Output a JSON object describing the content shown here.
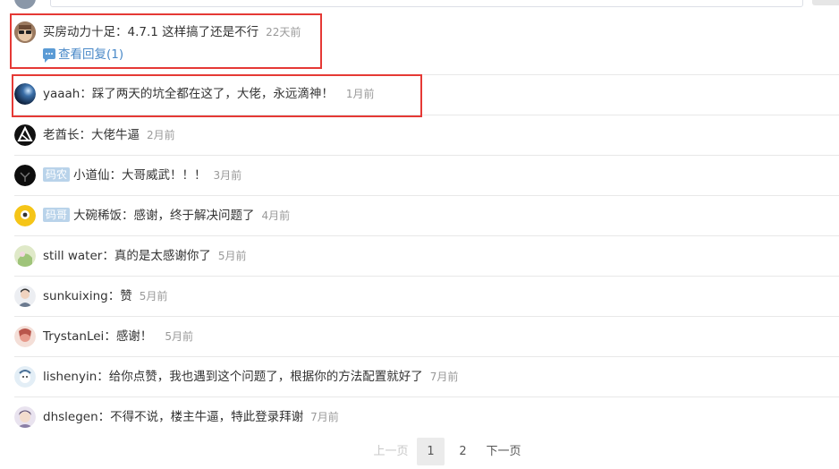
{
  "comments": [
    {
      "user": "买房动力十足",
      "text": "4.7.1 这样搞了还是不行",
      "time": "22天前",
      "reply_label": "查看回复(1)"
    },
    {
      "user": "yaaah",
      "text": "踩了两天的坑全都在这了，大佬，永远滴神！",
      "time": "1月前"
    },
    {
      "user": "老酋长",
      "text": "大佬牛逼",
      "time": "2月前"
    },
    {
      "user": "小道仙",
      "badge": "码农",
      "text": "大哥威武！！！",
      "time": "3月前"
    },
    {
      "user": "大碗稀饭",
      "badge": "码哥",
      "text": "感谢，终于解决问题了",
      "time": "4月前"
    },
    {
      "user": "still water",
      "text": "真的是太感谢你了",
      "time": "5月前"
    },
    {
      "user": "sunkuixing",
      "text": "赞",
      "time": "5月前"
    },
    {
      "user": "TrystanLei",
      "text": "感谢！",
      "time": "5月前"
    },
    {
      "user": "lishenyin",
      "text": "给你点赞，我也遇到这个问题了，根据你的方法配置就好了",
      "time": "7月前"
    },
    {
      "user": "dhslegen",
      "text": "不得不说，楼主牛逼，特此登录拜谢",
      "time": "7月前"
    }
  ],
  "pagination": {
    "prev": "上一页",
    "pages": [
      "1",
      "2"
    ],
    "current": "1",
    "next": "下一页"
  }
}
